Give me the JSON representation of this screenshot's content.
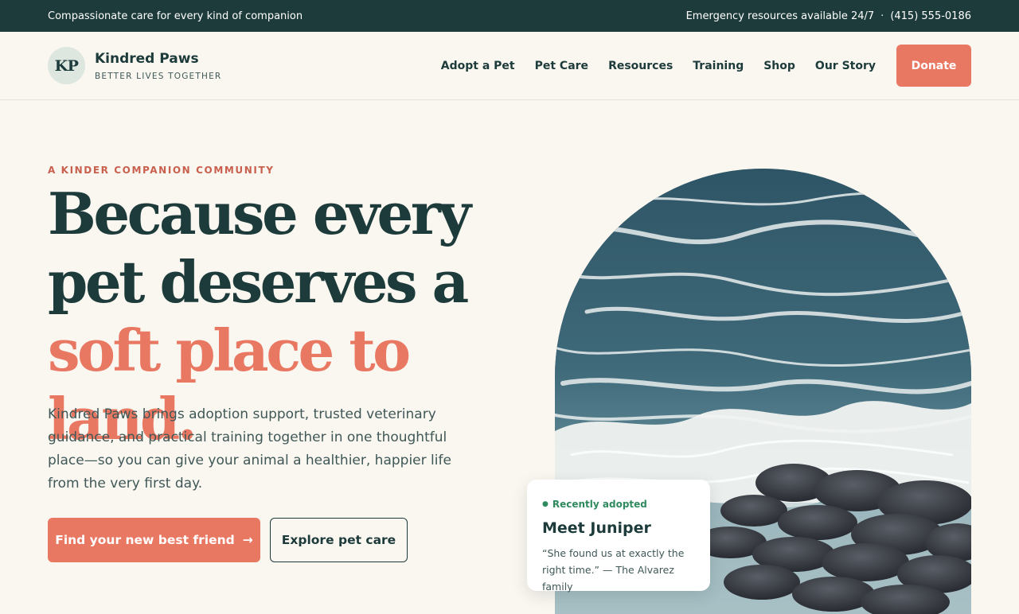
{
  "topbar": {
    "tagline": "Compassionate care for every kind of companion",
    "emergency": "Emergency resources available 24/7",
    "separator": "·",
    "phone": "(415) 555-0186"
  },
  "brand": {
    "monogram": "KP",
    "name": "Kindred Paws",
    "tagline": "BETTER LIVES TOGETHER"
  },
  "nav": {
    "items": [
      {
        "label": "Adopt a Pet"
      },
      {
        "label": "Pet Care"
      },
      {
        "label": "Resources"
      },
      {
        "label": "Training"
      },
      {
        "label": "Shop"
      },
      {
        "label": "Our Story"
      }
    ],
    "donate_label": "Donate"
  },
  "hero": {
    "eyebrow": "A KINDER COMPANION COMMUNITY",
    "headline_part1": "Because every pet deserves a ",
    "headline_accent": "soft place to land.",
    "lede": "Kindred Paws brings adoption support, trusted veterinary guidance, and practical training together in one thoughtful place—so you can give your animal a healthier, happier life from the very first day.",
    "primary_cta": "Find your new best friend",
    "primary_arrow": "→",
    "secondary_cta": "Explore pet care"
  },
  "card": {
    "bullet": "●",
    "badge": "Recently adopted",
    "title": "Meet Juniper",
    "quote": "“She found us at exactly the right time.” — The Alvarez family"
  },
  "colors": {
    "dark_teal": "#1c3b3a",
    "coral": "#e97863",
    "cream": "#faf6f0",
    "badge_green": "#2f8a5e"
  }
}
